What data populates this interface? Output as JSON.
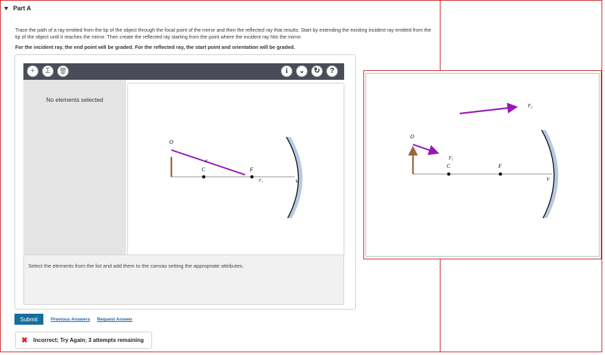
{
  "part": {
    "title": "Part A"
  },
  "question": {
    "instructions": "Trace the path of a ray emitted from the tip of the object through the focal point of the mirror and then the reflected ray that results. Start by extending the existing incident ray emitted from the tip of the object until it reaches the mirror. Then create the reflected ray starting from the point where the incident ray hits the mirror.",
    "grading_note": "For the incident ray, the end point will be graded. For the reflected ray, the start point and orientation will be graded."
  },
  "toolbar": {
    "left_icons": [
      "plus-icon",
      "sigma-icon",
      "trash-icon"
    ],
    "right_icons": [
      "info-icon",
      "chevron-down-icon",
      "reset-icon",
      "help-icon"
    ],
    "glyphs": {
      "plus": "+",
      "sigma": "Σ",
      "trash": "🗑",
      "info": "i",
      "chevron": "⌄",
      "reset": "↻",
      "help": "?"
    }
  },
  "sidebar": {
    "status": "No elements selected"
  },
  "canvas": {
    "labels": {
      "object": "O",
      "center": "C",
      "focus": "F",
      "vertex": "V",
      "f1": "F",
      "f2": "F₂"
    },
    "colors": {
      "ray": "#9b16b6",
      "object": "#a0643c",
      "mirror": "#b7c8e3"
    }
  },
  "hint": "Select the elements from the list and add them to the canvas setting the appropriate attributes.",
  "actions": {
    "submit": "Submit",
    "previous_answers": "Previous Answers",
    "request_answer": "Request Answer"
  },
  "feedback": {
    "message": "Incorrect; Try Again; 3 attempts remaining"
  },
  "reference": {
    "labels": {
      "object": "O",
      "center": "C",
      "focus": "F",
      "vertex": "V",
      "f1": "F₁",
      "f2": "F₂"
    }
  }
}
